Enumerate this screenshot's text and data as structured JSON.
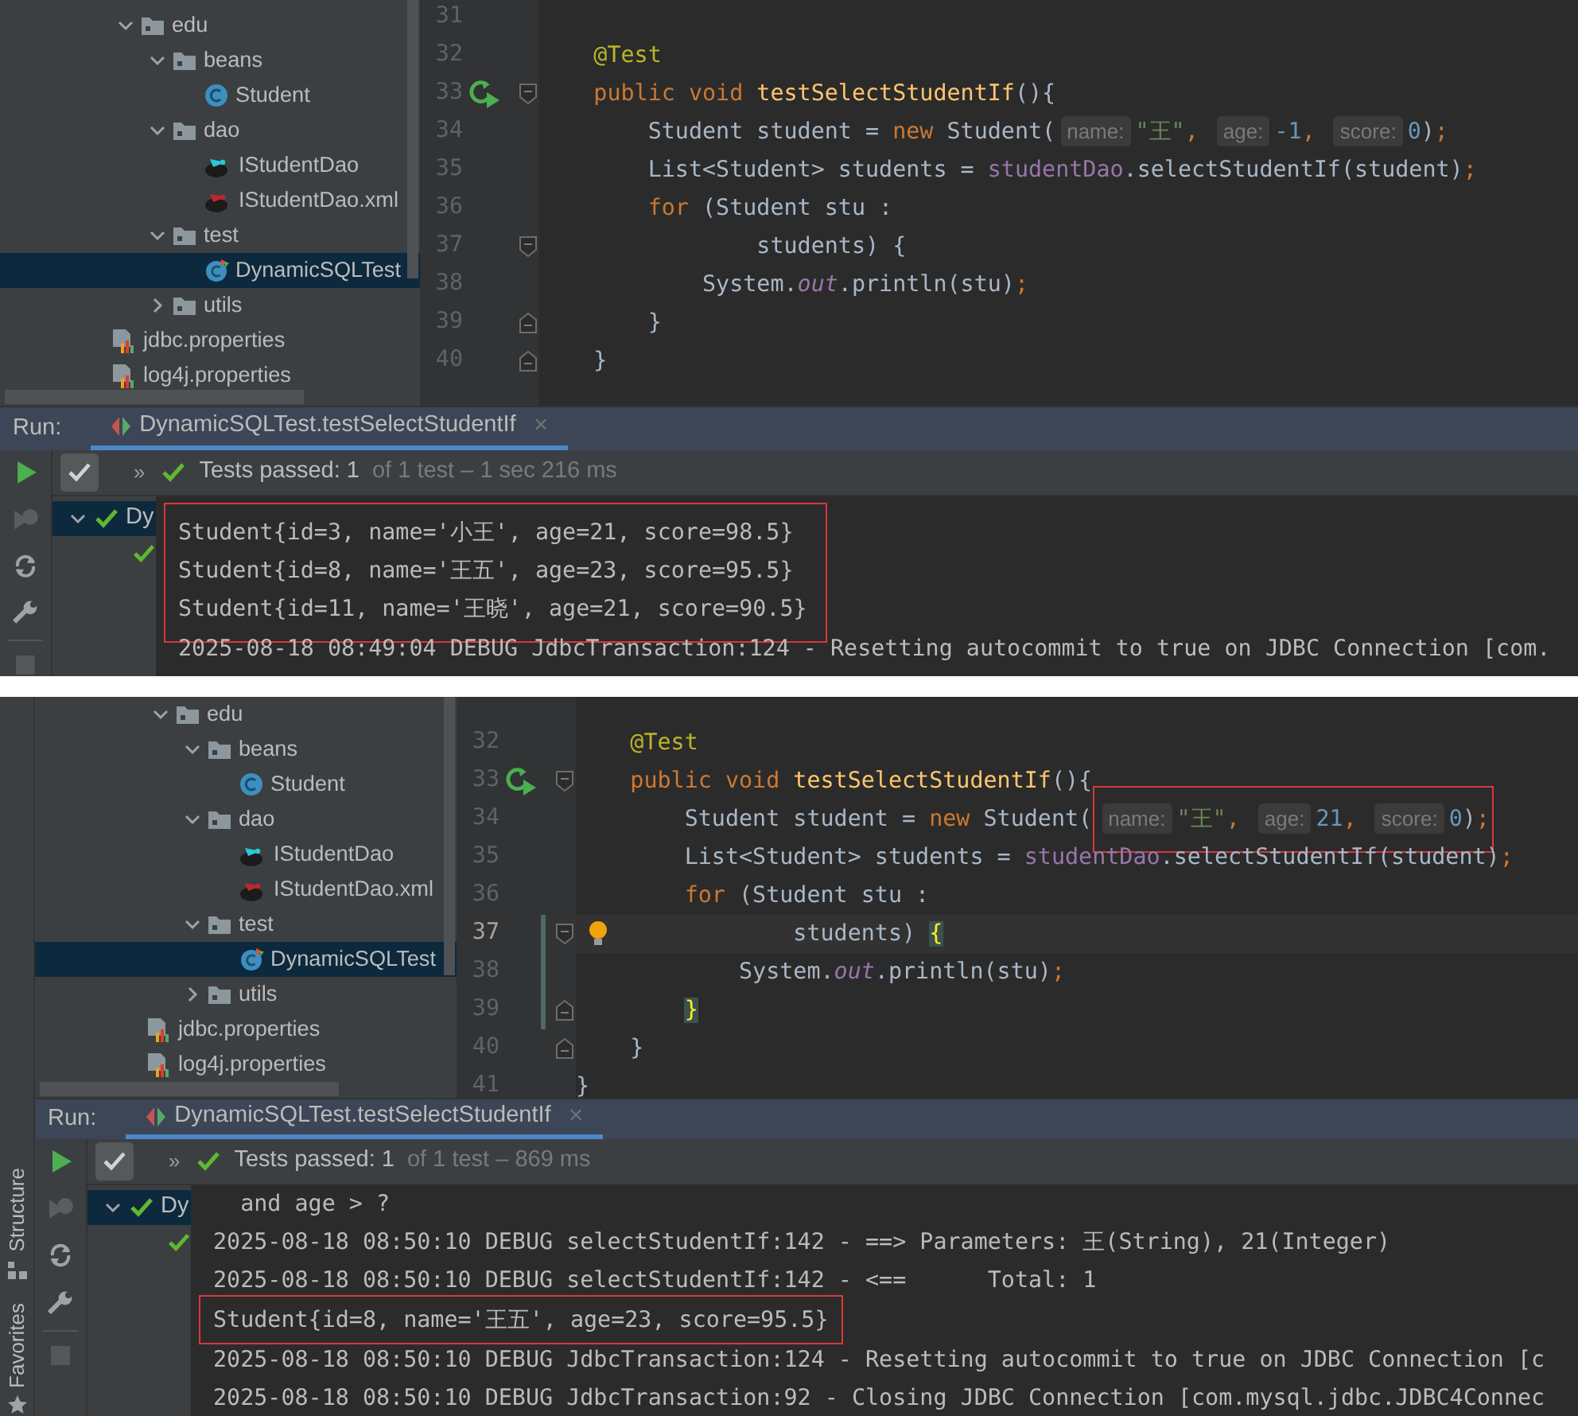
{
  "screens": [
    {
      "project_tree": {
        "packages": [
          {
            "label": "edu",
            "kind": "folder",
            "expanded": true,
            "selected": false,
            "children": [
              {
                "label": "beans",
                "kind": "folder",
                "expanded": true,
                "selected": false,
                "children": [
                  {
                    "label": "Student",
                    "kind": "class",
                    "selected": false
                  }
                ]
              },
              {
                "label": "dao",
                "kind": "folder",
                "expanded": true,
                "selected": false,
                "children": [
                  {
                    "label": "IStudentDao",
                    "kind": "mapper",
                    "selected": false
                  },
                  {
                    "label": "IStudentDao.xml",
                    "kind": "mapper-xml",
                    "selected": false
                  }
                ]
              },
              {
                "label": "test",
                "kind": "folder",
                "expanded": true,
                "selected": false,
                "children": [
                  {
                    "label": "DynamicSQLTest",
                    "kind": "test-class",
                    "selected": true
                  }
                ]
              },
              {
                "label": "utils",
                "kind": "folder",
                "expanded": false,
                "selected": false
              }
            ]
          }
        ],
        "resource_files": [
          {
            "label": "jdbc.properties",
            "kind": "properties",
            "selected": false
          },
          {
            "label": "log4j.properties",
            "kind": "properties",
            "selected": false
          }
        ]
      },
      "editor": {
        "lines": [
          {
            "number": "31"
          },
          {
            "number": "32",
            "tokens": [
              {
                "kind": "annotation",
                "text": "    @Test"
              }
            ]
          },
          {
            "number": "33",
            "run_marker": true,
            "fold_start": true,
            "tokens": [
              {
                "kind": "keyword",
                "text": "    public void "
              },
              {
                "kind": "method",
                "text": "testSelectStudentIf"
              },
              {
                "kind": "plain",
                "text": "(){"
              }
            ]
          },
          {
            "number": "34",
            "tokens": [
              {
                "kind": "plain",
                "text": "        Student student = "
              },
              {
                "kind": "keyword",
                "text": "new"
              },
              {
                "kind": "plain",
                "text": " Student("
              },
              {
                "kind": "hint",
                "text": "name:"
              },
              {
                "kind": "string",
                "text": "\"王\""
              },
              {
                "kind": "punct",
                "text": ", "
              },
              {
                "kind": "hint",
                "text": "age:"
              },
              {
                "kind": "number",
                "text": "-1"
              },
              {
                "kind": "punct",
                "text": ", "
              },
              {
                "kind": "hint",
                "text": "score:"
              },
              {
                "kind": "number",
                "text": "0"
              },
              {
                "kind": "plain",
                "text": ")"
              },
              {
                "kind": "punct",
                "text": ";"
              }
            ]
          },
          {
            "number": "35",
            "tokens": [
              {
                "kind": "plain",
                "text": "        List<Student> students = "
              },
              {
                "kind": "field",
                "text": "studentDao"
              },
              {
                "kind": "plain",
                "text": ".selectStudentIf(student)"
              },
              {
                "kind": "punct",
                "text": ";"
              }
            ]
          },
          {
            "number": "36",
            "tokens": [
              {
                "kind": "keyword",
                "text": "        for"
              },
              {
                "kind": "plain",
                "text": " (Student stu :"
              }
            ]
          },
          {
            "number": "37",
            "fold_start": true,
            "tokens": [
              {
                "kind": "plain",
                "text": "                students) {"
              }
            ]
          },
          {
            "number": "38",
            "tokens": [
              {
                "kind": "plain",
                "text": "            System."
              },
              {
                "kind": "field-italic",
                "text": "out"
              },
              {
                "kind": "plain",
                "text": ".println(stu)"
              },
              {
                "kind": "punct",
                "text": ";"
              }
            ]
          },
          {
            "number": "39",
            "fold_end": true,
            "tokens": [
              {
                "kind": "plain",
                "text": "        }"
              }
            ]
          },
          {
            "number": "40",
            "fold_end": true,
            "tokens": [
              {
                "kind": "plain",
                "text": "    }"
              }
            ]
          }
        ]
      },
      "run_panel": {
        "label": "Run:",
        "tabs": [
          {
            "title": "DynamicSQLTest.testSelectStudentIf",
            "close": "×",
            "selected": true
          }
        ],
        "show_passed_on": true,
        "more": "»",
        "status": "Tests passed: 1",
        "status_detail": "of 1 test – 1 sec 216 ms",
        "test_tree": [
          {
            "label": "Dy",
            "passed": true,
            "expanded": true,
            "selected": true,
            "children": [
              {
                "passed": true,
                "selected": false
              }
            ]
          }
        ],
        "console": [
          {
            "text": "Student{id=3, name='小王', age=21, score=98.5}",
            "boxed": true
          },
          {
            "text": "Student{id=8, name='王五', age=23, score=95.5}",
            "boxed": true
          },
          {
            "text": "Student{id=11, name='王晓', age=21, score=90.5}",
            "boxed": true
          },
          {
            "text": "2025-08-18 08:49:04 DEBUG JdbcTransaction:124 - Resetting autocommit to true on JDBC Connection [com.",
            "boxed": false
          }
        ]
      }
    },
    {
      "side_tabs": [
        {
          "label": "Structure",
          "kind": "structure"
        },
        {
          "label": "Favorites",
          "kind": "favorites"
        }
      ],
      "project_tree": {
        "packages": [
          {
            "label": "edu",
            "kind": "folder",
            "expanded": true,
            "selected": false,
            "children": [
              {
                "label": "beans",
                "kind": "folder",
                "expanded": true,
                "selected": false,
                "children": [
                  {
                    "label": "Student",
                    "kind": "class",
                    "selected": false
                  }
                ]
              },
              {
                "label": "dao",
                "kind": "folder",
                "expanded": true,
                "selected": false,
                "children": [
                  {
                    "label": "IStudentDao",
                    "kind": "mapper",
                    "selected": false
                  },
                  {
                    "label": "IStudentDao.xml",
                    "kind": "mapper-xml",
                    "selected": false
                  }
                ]
              },
              {
                "label": "test",
                "kind": "folder",
                "expanded": true,
                "selected": false,
                "children": [
                  {
                    "label": "DynamicSQLTest",
                    "kind": "test-class",
                    "selected": true
                  }
                ]
              },
              {
                "label": "utils",
                "kind": "folder",
                "expanded": false,
                "selected": false
              }
            ]
          }
        ],
        "resource_files": [
          {
            "label": "jdbc.properties",
            "kind": "properties",
            "selected": false
          },
          {
            "label": "log4j.properties",
            "kind": "properties",
            "selected": false
          }
        ]
      },
      "editor": {
        "lines": [
          {
            "number": "32",
            "tokens": [
              {
                "kind": "annotation",
                "text": "    @Test"
              }
            ]
          },
          {
            "number": "33",
            "run_marker": true,
            "fold_start": true,
            "tokens": [
              {
                "kind": "keyword",
                "text": "    public void "
              },
              {
                "kind": "method",
                "text": "testSelectStudentIf"
              },
              {
                "kind": "plain",
                "text": "(){"
              }
            ]
          },
          {
            "number": "34",
            "tokens": [
              {
                "kind": "plain",
                "text": "        Student student = "
              },
              {
                "kind": "keyword",
                "text": "new"
              },
              {
                "kind": "plain",
                "text": " Student("
              },
              {
                "kind": "group",
                "boxed": true,
                "tokens": [
                  {
                    "kind": "hint",
                    "text": "name:"
                  },
                  {
                    "kind": "string",
                    "text": "\"王\""
                  },
                  {
                    "kind": "punct",
                    "text": ", "
                  },
                  {
                    "kind": "hint",
                    "text": "age:"
                  },
                  {
                    "kind": "number",
                    "text": "21"
                  },
                  {
                    "kind": "punct",
                    "text": ", "
                  },
                  {
                    "kind": "hint",
                    "text": "score:"
                  },
                  {
                    "kind": "number",
                    "text": "0"
                  },
                  {
                    "kind": "plain",
                    "text": ")"
                  },
                  {
                    "kind": "punct",
                    "text": ";"
                  }
                ]
              }
            ]
          },
          {
            "number": "35",
            "tokens": [
              {
                "kind": "plain",
                "text": "        List<Student> students = "
              },
              {
                "kind": "field",
                "text": "studentDao"
              },
              {
                "kind": "plain",
                "text": ".selectStudentIf(student)"
              },
              {
                "kind": "punct",
                "text": ";"
              }
            ]
          },
          {
            "number": "36",
            "tokens": [
              {
                "kind": "keyword",
                "text": "        for"
              },
              {
                "kind": "plain",
                "text": " (Student stu :"
              }
            ]
          },
          {
            "number": "37",
            "current": true,
            "vcs_changed": true,
            "bulb": true,
            "fold_start": true,
            "tokens": [
              {
                "kind": "plain",
                "text": "                students) "
              },
              {
                "kind": "brace-match",
                "text": "{"
              }
            ]
          },
          {
            "number": "38",
            "vcs_changed": true,
            "tokens": [
              {
                "kind": "plain",
                "text": "            System."
              },
              {
                "kind": "field-italic",
                "text": "out"
              },
              {
                "kind": "plain",
                "text": ".println(stu)"
              },
              {
                "kind": "punct",
                "text": ";"
              }
            ]
          },
          {
            "number": "39",
            "vcs_changed": true,
            "fold_end": true,
            "tokens": [
              {
                "kind": "brace-match",
                "text": "        }"
              }
            ]
          },
          {
            "number": "40",
            "fold_end": true,
            "tokens": [
              {
                "kind": "plain",
                "text": "    }"
              }
            ]
          },
          {
            "number": "41",
            "tokens": [
              {
                "kind": "plain",
                "text": "}"
              }
            ]
          }
        ]
      },
      "run_panel": {
        "label": "Run:",
        "tabs": [
          {
            "title": "DynamicSQLTest.testSelectStudentIf",
            "close": "×",
            "selected": true
          }
        ],
        "show_passed_on": true,
        "more": "»",
        "status": "Tests passed: 1",
        "status_detail": "of 1 test – 869 ms",
        "test_tree": [
          {
            "label": "Dy",
            "passed": true,
            "expanded": true,
            "selected": true,
            "children": [
              {
                "passed": true,
                "selected": false
              }
            ]
          }
        ],
        "console": [
          {
            "text": "  and age > ?",
            "boxed": false
          },
          {
            "text": "2025-08-18 08:50:10 DEBUG selectStudentIf:142 - ==> Parameters: 王(String), 21(Integer)",
            "boxed": false
          },
          {
            "text": "2025-08-18 08:50:10 DEBUG selectStudentIf:142 - <==      Total: 1",
            "boxed": false
          },
          {
            "text": "Student{id=8, name='王五', age=23, score=95.5}",
            "boxed": true
          },
          {
            "text": "2025-08-18 08:50:10 DEBUG JdbcTransaction:124 - Resetting autocommit to true on JDBC Connection [c",
            "boxed": false
          },
          {
            "text": "2025-08-18 08:50:10 DEBUG JdbcTransaction:92 - Closing JDBC Connection [com.mysql.jdbc.JDBC4Connec",
            "boxed": false
          }
        ]
      }
    }
  ]
}
